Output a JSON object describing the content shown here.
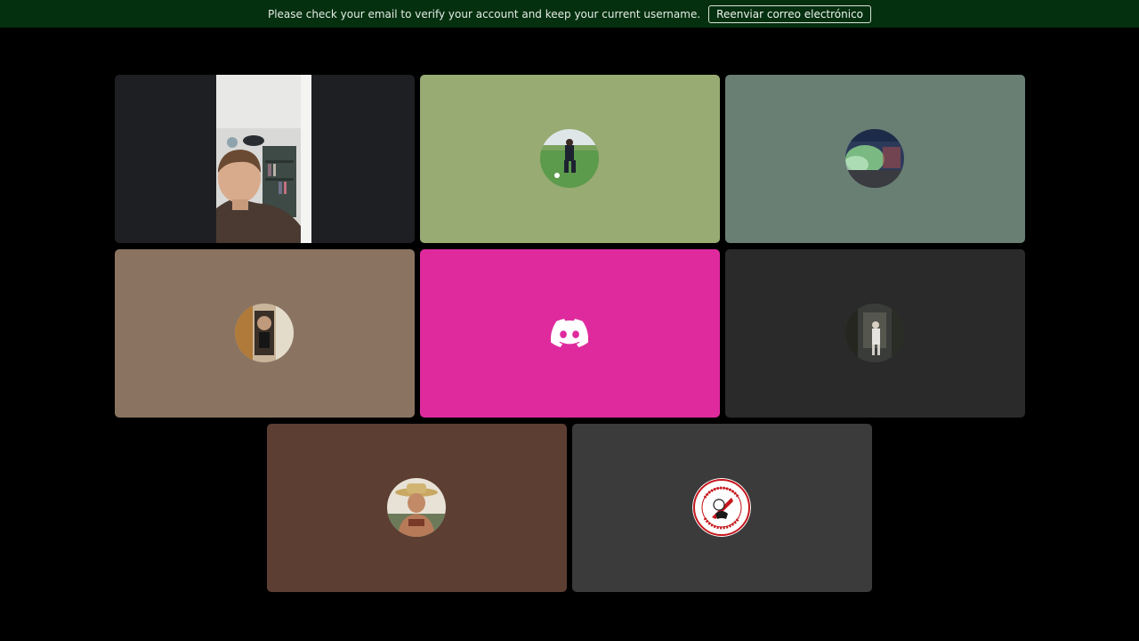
{
  "banner": {
    "message": "Please check your email to verify your account and keep your current username.",
    "button_label": "Reenviar correo electrónico",
    "background": "#04300f"
  },
  "tiles": [
    {
      "id": "self-video",
      "kind": "video",
      "background": "#1e1f22"
    },
    {
      "id": "soccer-player",
      "kind": "avatar",
      "background": "#97ab72",
      "icon": "soccer-player-avatar"
    },
    {
      "id": "stadium",
      "kind": "avatar",
      "background": "#6a7f74",
      "icon": "stadium-smoke-avatar"
    },
    {
      "id": "selfie",
      "kind": "avatar",
      "background": "#8a7461",
      "icon": "selfie-avatar"
    },
    {
      "id": "discord-default",
      "kind": "logo",
      "background": "#df2a9e",
      "icon": "discord-icon"
    },
    {
      "id": "street",
      "kind": "avatar",
      "background": "#2a2a2a",
      "icon": "street-person-avatar"
    },
    {
      "id": "straw-hat",
      "kind": "avatar",
      "background": "#5c3e32",
      "icon": "straw-hat-avatar"
    },
    {
      "id": "river-plate",
      "kind": "avatar",
      "background": "#3b3b3b",
      "icon": "river-plate-crest-icon"
    }
  ]
}
